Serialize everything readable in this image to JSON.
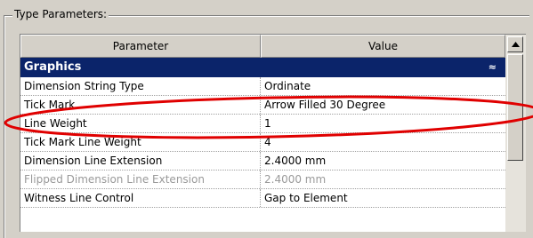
{
  "groupbox": {
    "title": "Type Parameters:"
  },
  "grid": {
    "columns": {
      "parameter": "Parameter",
      "value": "Value"
    },
    "group": {
      "label": "Graphics",
      "toggle": "≈"
    },
    "rows": [
      {
        "parameter": "Dimension String Type",
        "value": "Ordinate",
        "enabled": true
      },
      {
        "parameter": "Tick Mark",
        "value": "Arrow Filled 30 Degree",
        "enabled": true
      },
      {
        "parameter": "Line Weight",
        "value": "1",
        "enabled": true
      },
      {
        "parameter": "Tick Mark Line Weight",
        "value": "4",
        "enabled": true
      },
      {
        "parameter": "Dimension Line Extension",
        "value": "2.4000 mm",
        "enabled": true
      },
      {
        "parameter": "Flipped Dimension Line Extension",
        "value": "2.4000 mm",
        "enabled": false
      },
      {
        "parameter": "Witness Line Control",
        "value": "Gap to Element",
        "enabled": true
      }
    ]
  },
  "colors": {
    "group_header_bg": "#0b246a",
    "annotation_ellipse": "#e00000",
    "disabled_text": "#9a9a9a"
  },
  "icons": {
    "scroll_up": "up-arrow-icon"
  }
}
